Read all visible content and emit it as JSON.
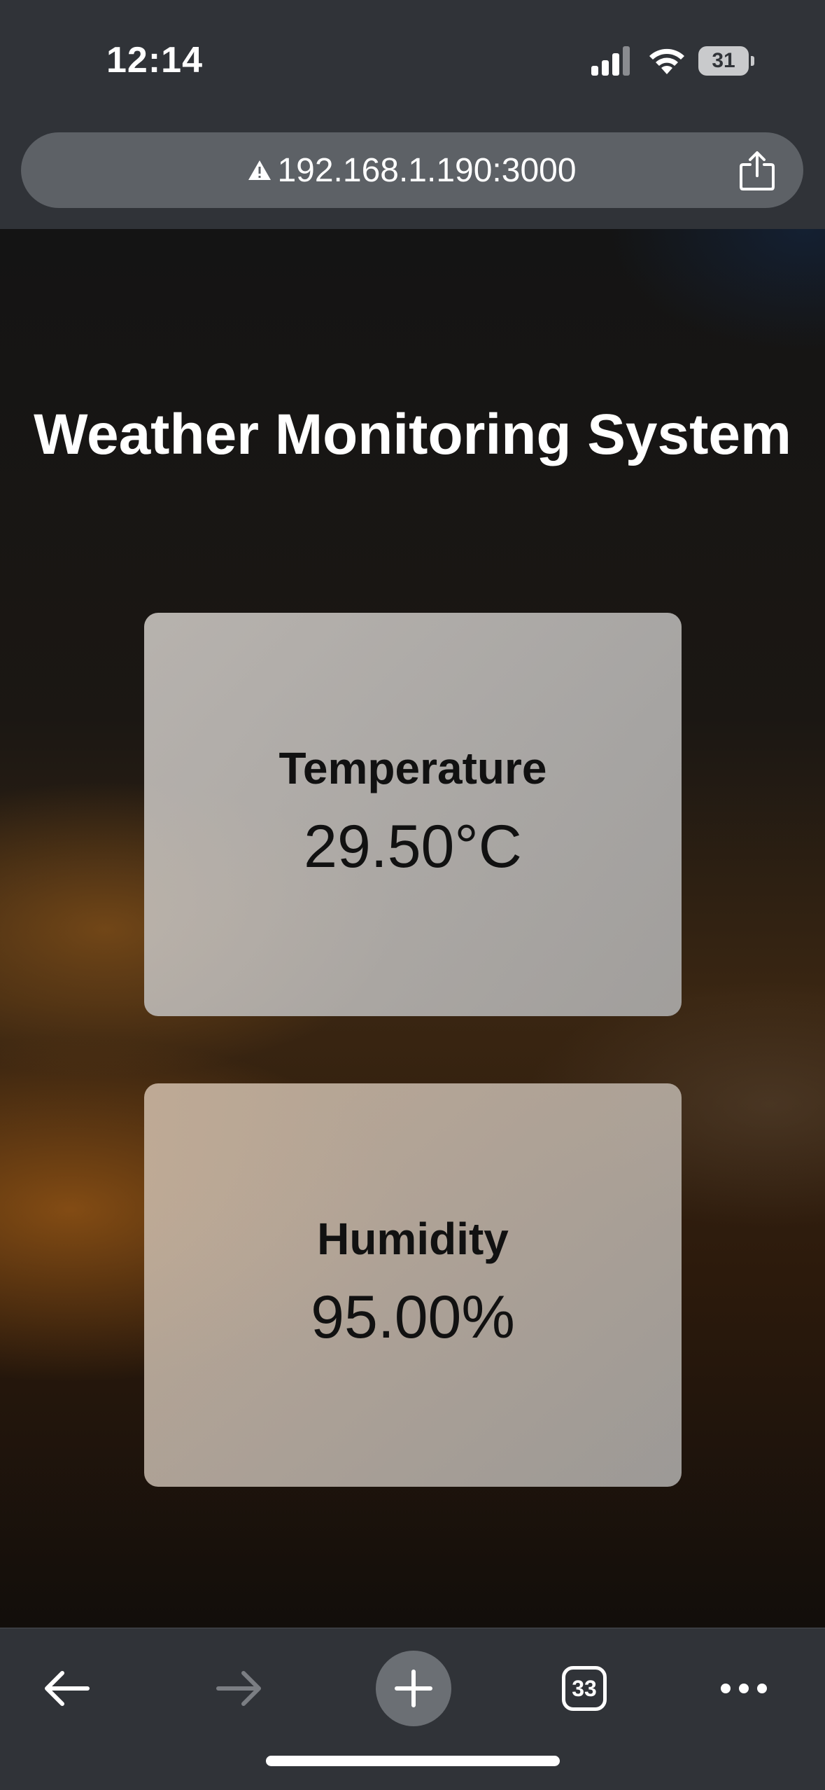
{
  "status_bar": {
    "time": "12:14",
    "battery_level": "31"
  },
  "browser": {
    "url": "192.168.1.190:3000",
    "tab_count": "33",
    "icons": {
      "warning": "warning-triangle-icon",
      "share": "share-icon",
      "back": "arrow-left-icon",
      "forward": "arrow-right-icon",
      "new_tab": "plus-icon",
      "tabs": "tabs-icon",
      "more": "ellipsis-icon"
    }
  },
  "page": {
    "title": "Weather Monitoring System",
    "cards": [
      {
        "label": "Temperature",
        "value": "29.50°C"
      },
      {
        "label": "Humidity",
        "value": "95.00%"
      }
    ]
  },
  "colors": {
    "chrome_background": "#303338",
    "url_bar": "#5d6166",
    "card_text": "#111111",
    "title_text": "#ffffff"
  }
}
